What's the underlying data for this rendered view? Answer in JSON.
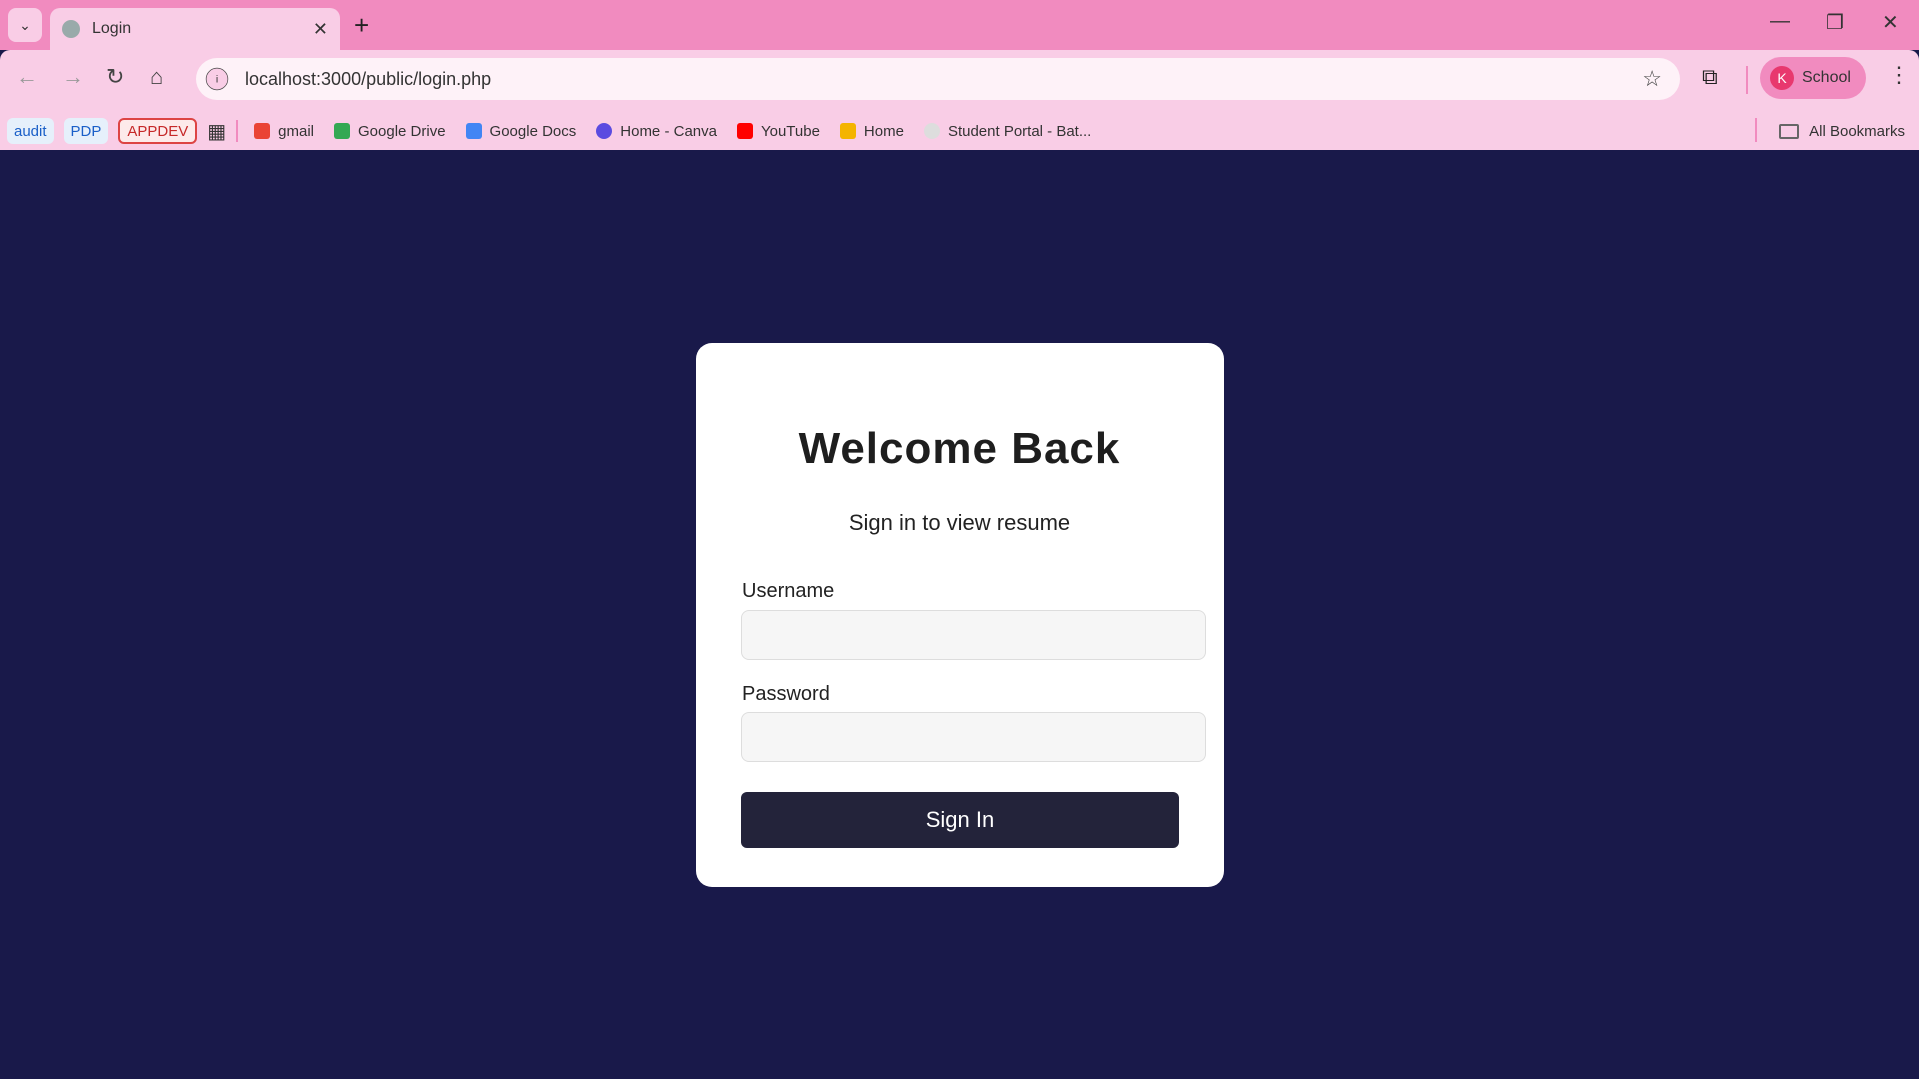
{
  "browser": {
    "tab_title": "Login",
    "url": "localhost:3000/public/login.php",
    "profile_initial": "K",
    "profile_name": "School",
    "bookmarks": {
      "chips": [
        "audit",
        "PDP",
        "APPDEV"
      ],
      "items": [
        "gmail",
        "Google Drive",
        "Google Docs",
        "Home - Canva",
        "YouTube",
        "Home",
        "Student Portal - Bat..."
      ],
      "all_bookmarks": "All Bookmarks"
    }
  },
  "login": {
    "title": "Welcome Back",
    "subtitle": "Sign in to view resume",
    "username_label": "Username",
    "username_value": "",
    "password_label": "Password",
    "password_value": "",
    "submit_label": "Sign In"
  },
  "colors": {
    "background": "#19194a",
    "button": "#23233a",
    "browser_frame": "#f18bbf"
  }
}
